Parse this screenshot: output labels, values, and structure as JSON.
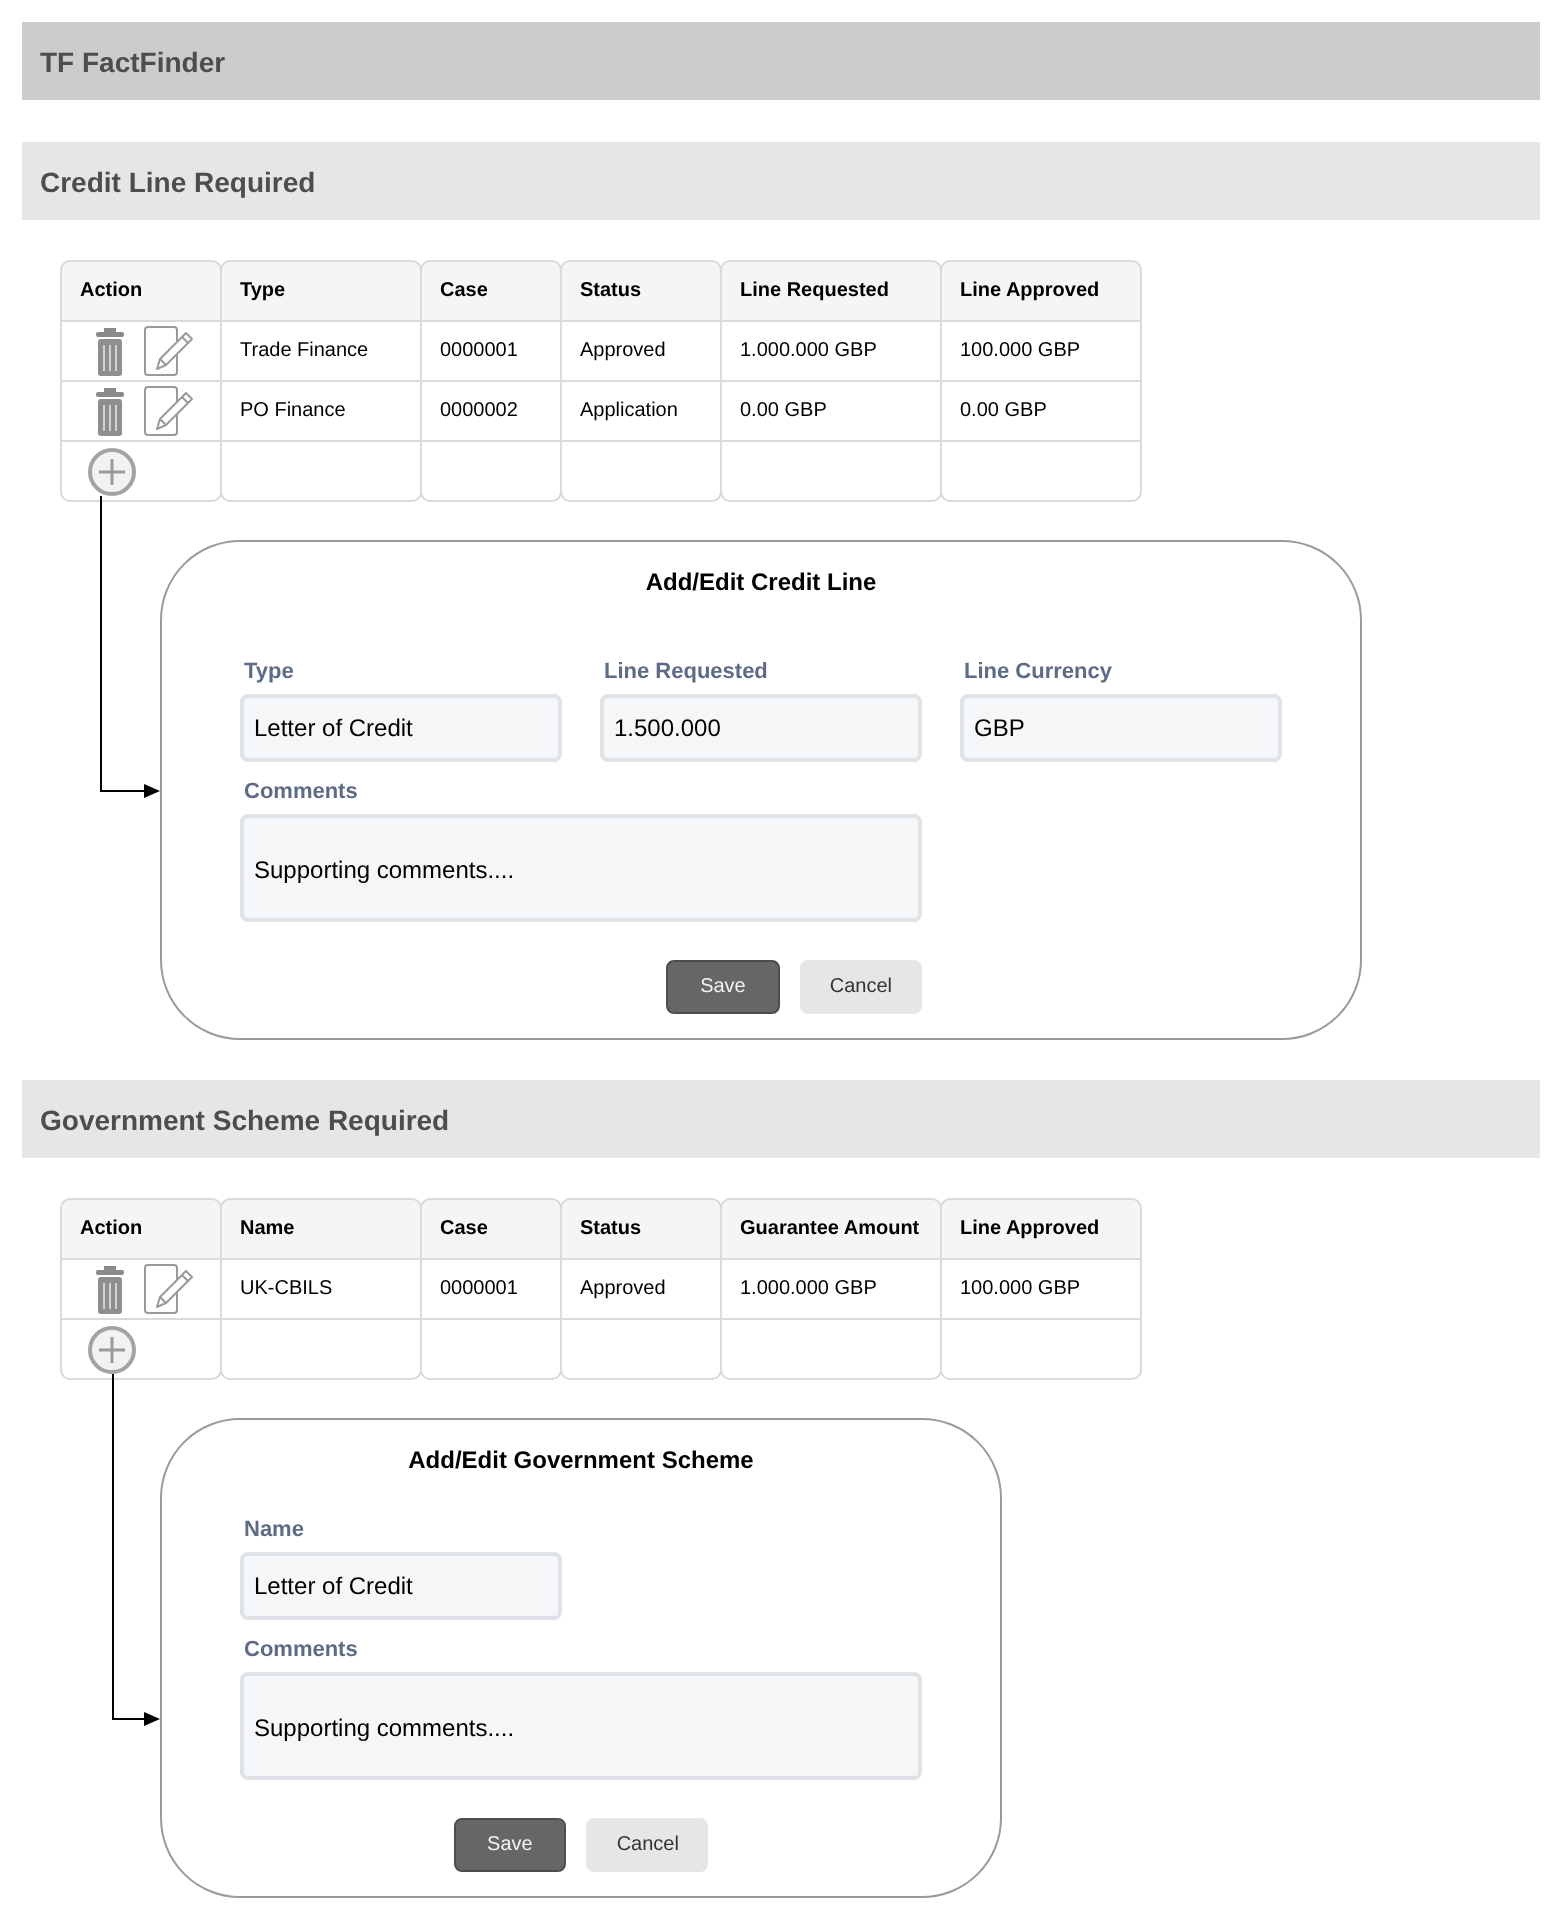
{
  "app_title": "TF FactFinder",
  "sections": [
    {
      "title": "Credit Line Required",
      "table": {
        "columns": [
          "Action",
          "Type",
          "Case",
          "Status",
          "Line Requested",
          "Line Approved"
        ],
        "rows": [
          {
            "cells": [
              "",
              "Trade Finance",
              "0000001",
              "Approved",
              "1.000.000 GBP",
              "100.000 GBP"
            ]
          },
          {
            "cells": [
              "",
              "PO Finance",
              "0000002",
              "Application",
              "0.00 GBP",
              "0.00 GBP"
            ]
          }
        ]
      },
      "dialog": {
        "title": "Add/Edit Credit Line",
        "fields": [
          {
            "kind": "text",
            "label": "Type",
            "value": "Letter of Credit"
          },
          {
            "kind": "text",
            "label": "Line Requested",
            "value": "1.500.000"
          },
          {
            "kind": "text",
            "label": "Line Currency",
            "value": "GBP"
          },
          {
            "kind": "textarea",
            "label": "Comments",
            "value": "Supporting comments...."
          }
        ],
        "buttons": [
          {
            "kind": "primary",
            "label": "Save"
          },
          {
            "kind": "secondary",
            "label": "Cancel"
          }
        ]
      }
    },
    {
      "title": "Government Scheme Required",
      "table": {
        "columns": [
          "Action",
          "Name",
          "Case",
          "Status",
          "Guarantee Amount",
          "Line Approved"
        ],
        "rows": [
          {
            "cells": [
              "",
              "UK-CBILS",
              "0000001",
              "Approved",
              "1.000.000 GBP",
              "100.000 GBP"
            ]
          }
        ]
      },
      "dialog": {
        "title": "Add/Edit Government Scheme",
        "fields": [
          {
            "kind": "text",
            "label": "Name",
            "value": "Letter of Credit"
          },
          {
            "kind": "textarea",
            "label": "Comments",
            "value": "Supporting comments...."
          }
        ],
        "buttons": [
          {
            "kind": "primary",
            "label": "Save"
          },
          {
            "kind": "secondary",
            "label": "Cancel"
          }
        ]
      }
    }
  ]
}
